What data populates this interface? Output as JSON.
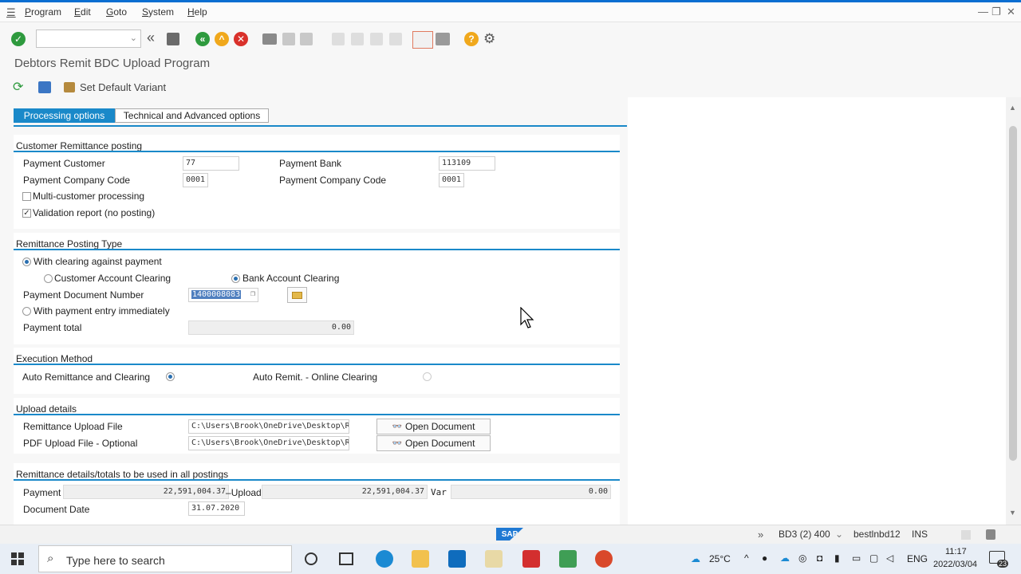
{
  "menu": {
    "items": [
      "Program",
      "Edit",
      "Goto",
      "System",
      "Help"
    ]
  },
  "window_controls": {
    "minimize": "—",
    "restore": "❐",
    "close": "✕"
  },
  "page_title": "Debtors Remit BDC Upload Program",
  "app_toolbar": {
    "variant_label": "Set Default Variant"
  },
  "tabs": [
    {
      "label": "Processing options",
      "active": true
    },
    {
      "label": "Technical and Advanced options",
      "active": false
    }
  ],
  "customer_remittance": {
    "title": "Customer Remittance posting",
    "payment_customer_label": "Payment Customer",
    "payment_customer_value": "77",
    "payment_company_code_label": "Payment Company Code",
    "payment_company_code_value": "0001",
    "payment_bank_label": "Payment Bank",
    "payment_bank_value": "113109",
    "payment_company_code2_label": "Payment Company Code",
    "payment_company_code2_value": "0001",
    "multi_customer_label": "Multi-customer processing",
    "multi_customer_checked": false,
    "validation_report_label": "Validation report (no posting)",
    "validation_report_checked": true
  },
  "posting_type": {
    "title": "Remittance Posting Type",
    "with_clearing_label": "With clearing against payment",
    "customer_account_clearing_label": "Customer Account Clearing",
    "bank_account_clearing_label": "Bank Account Clearing",
    "payment_doc_number_label": "Payment Document Number",
    "payment_doc_number_value": "1400008083",
    "with_payment_entry_label": "With payment entry immediately",
    "payment_total_label": "Payment total",
    "payment_total_value": "0.00"
  },
  "execution": {
    "title": "Execution Method",
    "auto_remit_clearing_label": "Auto Remittance and Clearing",
    "auto_remit_online_label": "Auto Remit. - Online Clearing"
  },
  "upload": {
    "title": "Upload details",
    "remittance_file_label": "Remittance Upload File",
    "remittance_file_value": "C:\\Users\\Brook\\OneDrive\\Desktop\\R...",
    "pdf_file_label": "PDF Upload File - Optional",
    "pdf_file_value": "C:\\Users\\Brook\\OneDrive\\Desktop\\R...",
    "open_document_label": "Open Document"
  },
  "totals": {
    "title": "Remittance details/totals to be used in all postings",
    "payment_label": "Payment",
    "payment_value": "22,591,004.37",
    "upload_label": "Upload",
    "upload_value": "22,591,004.37",
    "var_label": "Var",
    "var_value": "0.00",
    "document_date_label": "Document Date",
    "document_date_value": "31.07.2020"
  },
  "status_bar": {
    "sap_logo": "SAP",
    "system": "BD3 (2) 400",
    "server": "bestlnbd12",
    "mode": "INS"
  },
  "taskbar": {
    "search_placeholder": "Type here to search",
    "temperature": "25°C",
    "language": "ENG",
    "time": "11:17",
    "date": "2022/03/04",
    "notifications": "23"
  },
  "colors": {
    "accent": "#1a89c9",
    "enter_icon": "#2e9a3e",
    "back_icon": "#2e9a3e",
    "exit_icon": "#f0a81c",
    "cancel_icon": "#d9312b",
    "help_icon": "#f0a81c"
  }
}
